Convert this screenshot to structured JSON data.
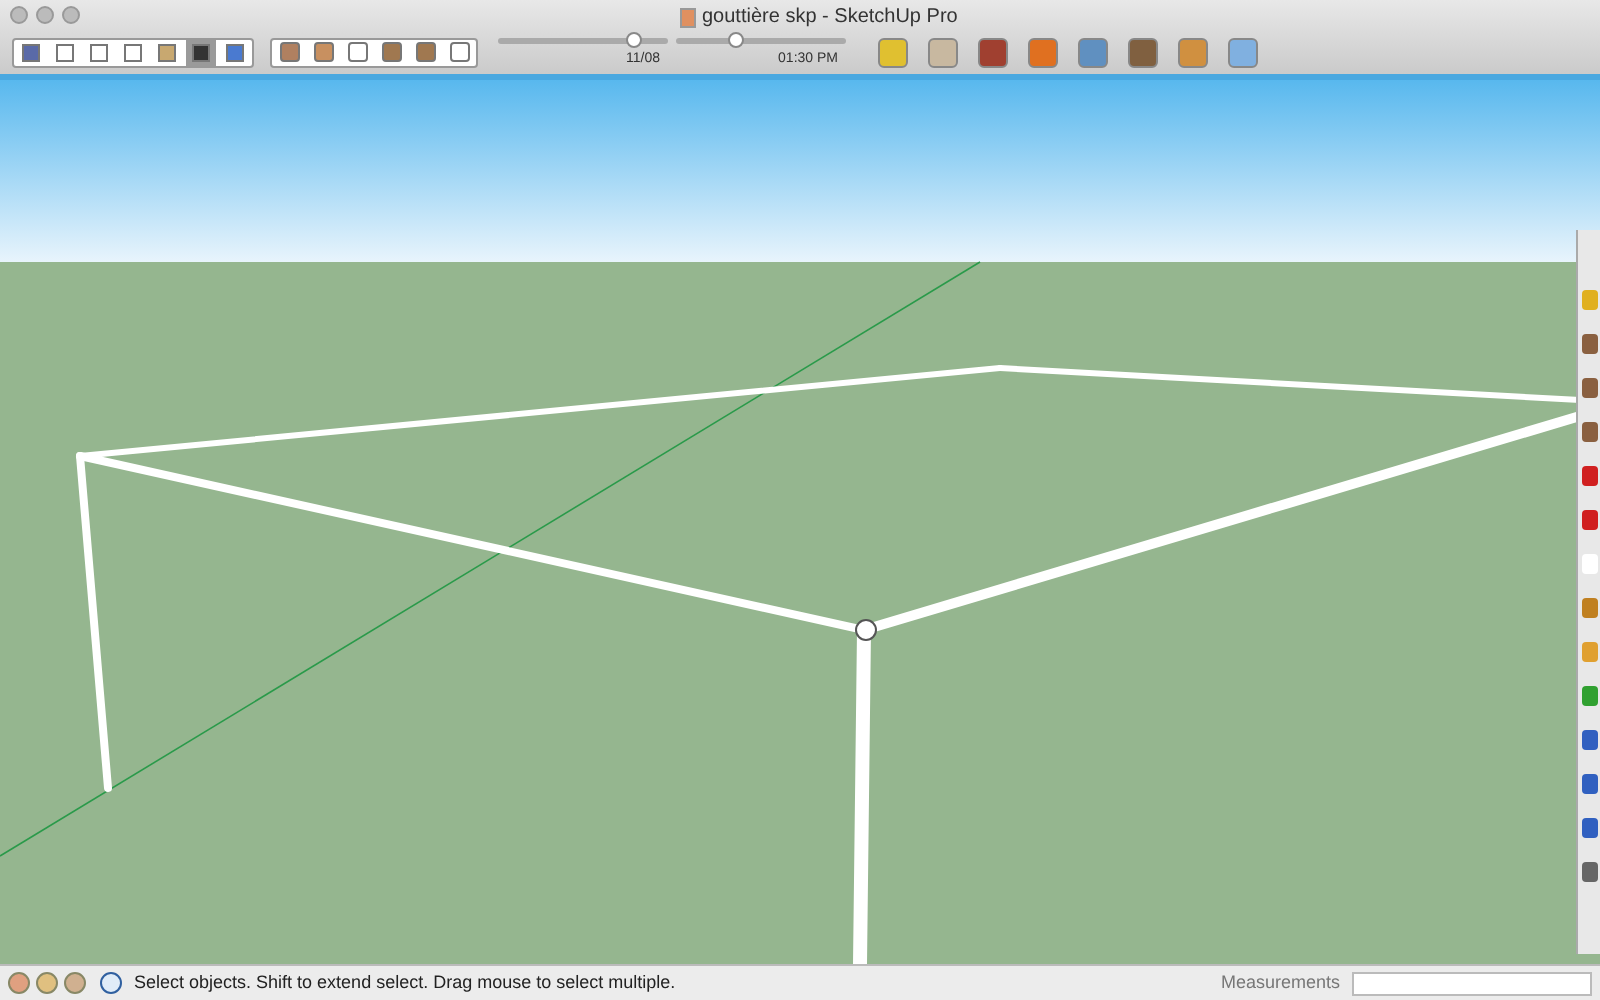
{
  "window": {
    "title": "gouttière skp - SketchUp Pro"
  },
  "toolbar": {
    "view_buttons": [
      {
        "selected": false
      },
      {
        "selected": false
      },
      {
        "selected": false
      },
      {
        "selected": false
      },
      {
        "selected": false
      },
      {
        "selected": true
      },
      {
        "selected": false
      }
    ],
    "shadow_sliders": [
      {
        "level": 0.8,
        "reading": "11/08"
      },
      {
        "level": 0.35,
        "reading": "01:30 PM"
      }
    ]
  },
  "status_bar": {
    "hint": "Select objects. Shift to extend select. Drag mouse to select multiple.",
    "measurements_label": "Measurements"
  }
}
